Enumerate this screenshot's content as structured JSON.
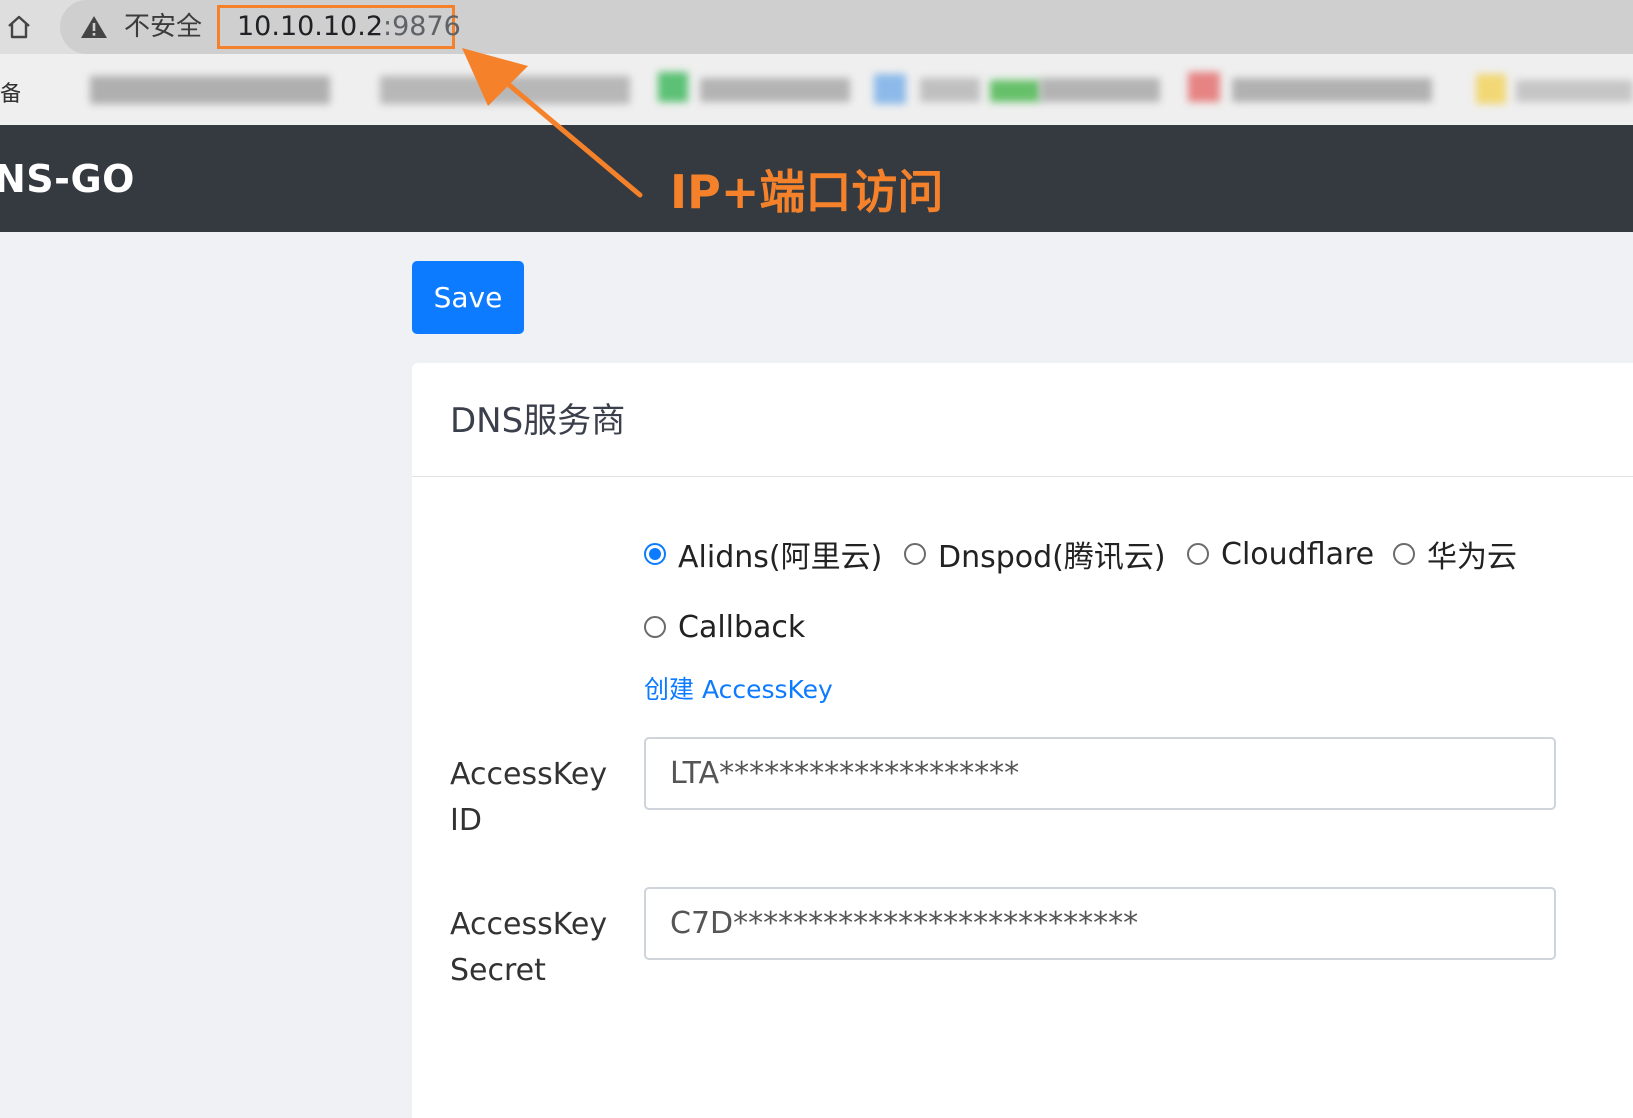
{
  "browser": {
    "security_label": "不安全",
    "url_host": "10.10.10.2",
    "url_port": ":9876",
    "bookmark_label_partial": "备"
  },
  "app": {
    "brand": "NS-GO",
    "save_label": "Save"
  },
  "annotation": {
    "text": "IP+端口访问",
    "color": "#f5822a"
  },
  "card": {
    "title": "DNS服务商",
    "providers": [
      {
        "label": "Alidns(阿里云)",
        "checked": true
      },
      {
        "label": "Dnspod(腾讯云)",
        "checked": false
      },
      {
        "label": "Cloudflare",
        "checked": false
      },
      {
        "label": "华为云",
        "checked": false
      },
      {
        "label": "Callback",
        "checked": false
      }
    ],
    "create_link": "创建 AccessKey",
    "fields": [
      {
        "label_line1": "AccessKey",
        "label_line2": "ID",
        "value": "LTA********************"
      },
      {
        "label_line1": "AccessKey",
        "label_line2": "Secret",
        "value": "C7D***************************"
      }
    ]
  },
  "colors": {
    "primary": "#0d7bff",
    "navbar": "#343a40",
    "page_bg": "#f0f1f5"
  },
  "icons": [
    "home-icon",
    "warning-icon"
  ]
}
